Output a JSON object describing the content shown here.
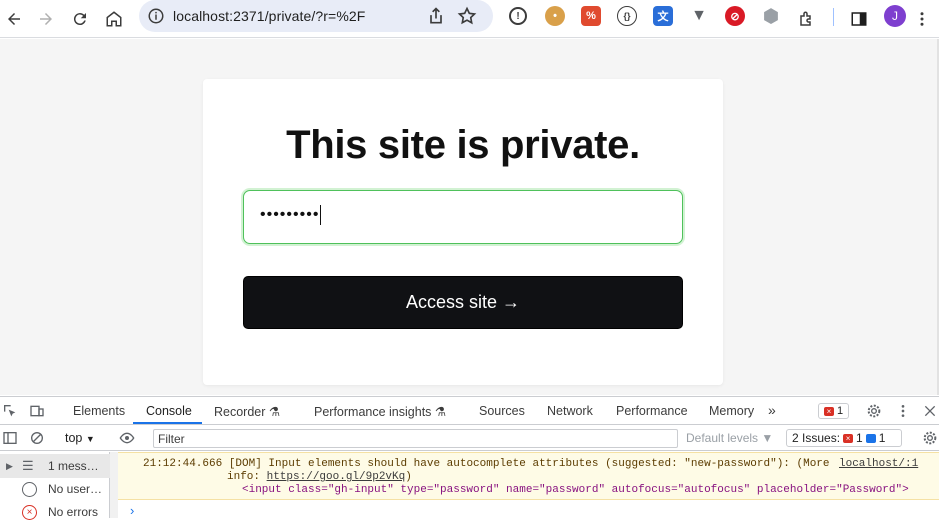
{
  "browser": {
    "url": "localhost:2371/private/?r=%2F",
    "avatar_letter": "J",
    "extensions": [
      "password-manager-icon",
      "cookie-icon",
      "pdf-icon",
      "code-icon",
      "translate-icon",
      "vue-icon",
      "block-icon",
      "hexagon-icon"
    ]
  },
  "page": {
    "title": "This site is private.",
    "password_mask": "•••••••••",
    "button_label": "Access site →"
  },
  "devtools": {
    "tabs": [
      "Elements",
      "Console",
      "Recorder",
      "Performance insights",
      "Sources",
      "Network",
      "Performance",
      "Memory"
    ],
    "active_tab": "Console",
    "error_count": "1",
    "context": "top",
    "filter_placeholder": "Filter",
    "levels": "Default levels",
    "issues_label": "2 Issues:",
    "issues_err": "1",
    "issues_info": "1",
    "sidebar": [
      "1 mess…",
      "No user…",
      "No errors"
    ],
    "message": {
      "line1": "21:12:44.666 [DOM] Input elements should have autocomplete attributes (suggested: \"new-password\"): (More",
      "line2_prefix": "info: ",
      "link": "https://goo.gl/9p2vKq",
      "line2_suffix": ")",
      "line3": "<input class=\"gh-input\" type=\"password\" name=\"password\" autofocus=\"autofocus\" placeholder=\"Password\">",
      "source": "localhost/:1"
    },
    "prompt": "›"
  },
  "colors": {
    "accent": "#1a73e8",
    "button_bg": "#101114",
    "focus_border": "#4fc15b"
  }
}
